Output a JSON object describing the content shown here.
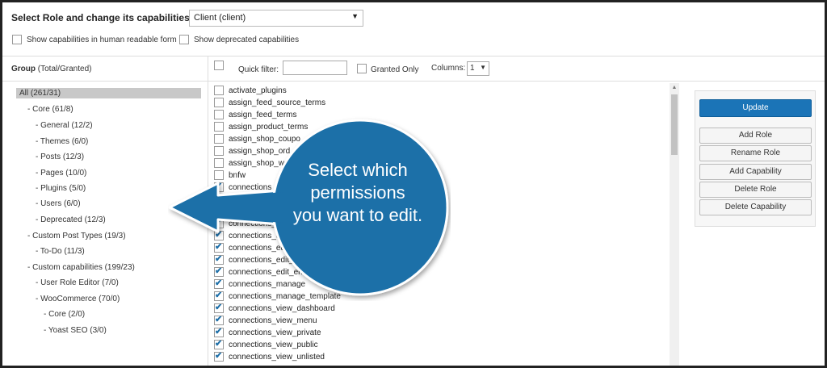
{
  "header": {
    "role_label": "Select Role and change its capabilities:",
    "role_select_value": "Client (client)",
    "show_human_readable_label": "Show capabilities in human readable form",
    "show_deprecated_label": "Show deprecated capabilities"
  },
  "group": {
    "title_bold": "Group",
    "title_rest": " (Total/Granted)",
    "items": [
      "All (261/31)",
      "- Core (61/8)",
      "- General (12/2)",
      "- Themes (6/0)",
      "- Posts (12/3)",
      "- Pages (10/0)",
      "- Plugins (5/0)",
      "- Users (6/0)",
      "- Deprecated (12/3)",
      "- Custom Post Types (19/3)",
      "- To-Do (11/3)",
      "- Custom capabilities (199/23)",
      "- User Role Editor (7/0)",
      "- WooCommerce (70/0)",
      "- Core (2/0)",
      "- Yoast SEO (3/0)"
    ]
  },
  "filter": {
    "quick_filter_label": "Quick filter:",
    "quick_filter_value": "",
    "granted_only_label": "Granted Only",
    "columns_label": "Columns:",
    "columns_value": "1"
  },
  "capabilities": [
    {
      "name": "activate_plugins",
      "checked": false
    },
    {
      "name": "assign_feed_source_terms",
      "checked": false
    },
    {
      "name": "assign_feed_terms",
      "checked": false
    },
    {
      "name": "assign_product_terms",
      "checked": false
    },
    {
      "name": "assign_shop_coupo",
      "checked": false
    },
    {
      "name": "assign_shop_ord",
      "checked": false
    },
    {
      "name": "assign_shop_w",
      "checked": false
    },
    {
      "name": "bnfw",
      "checked": false
    },
    {
      "name": "connections",
      "checked": true
    },
    {
      "name": "",
      "checked": true
    },
    {
      "name": "",
      "checked": true
    },
    {
      "name": "connections_",
      "checked": true
    },
    {
      "name": "connections_d",
      "checked": true
    },
    {
      "name": "connections_ed",
      "checked": true
    },
    {
      "name": "connections_edit_",
      "checked": true
    },
    {
      "name": "connections_edit_entr",
      "checked": true
    },
    {
      "name": "connections_manage",
      "checked": true
    },
    {
      "name": "connections_manage_template",
      "checked": true
    },
    {
      "name": "connections_view_dashboard",
      "checked": true
    },
    {
      "name": "connections_view_menu",
      "checked": true
    },
    {
      "name": "connections_view_private",
      "checked": true
    },
    {
      "name": "connections_view_public",
      "checked": true
    },
    {
      "name": "connections_view_unlisted",
      "checked": true
    }
  ],
  "actions": {
    "update": "Update",
    "add_role": "Add Role",
    "rename_role": "Rename Role",
    "add_capability": "Add Capability",
    "delete_role": "Delete Role",
    "delete_capability": "Delete Capability"
  },
  "callout": {
    "line1": "Select which",
    "line2": "permissions",
    "line3": "you want to edit.",
    "color": "#1b6fa8"
  }
}
